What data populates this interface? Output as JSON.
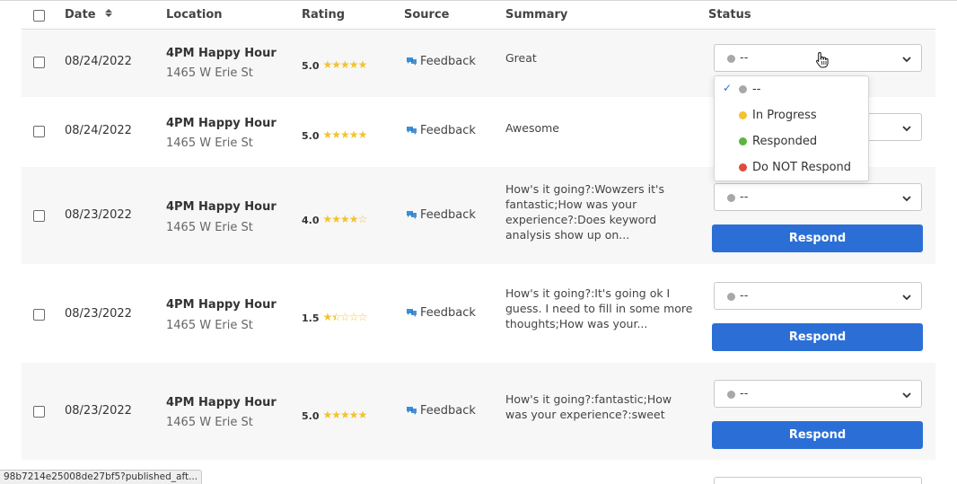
{
  "header": {
    "date": "Date",
    "location": "Location",
    "rating": "Rating",
    "source": "Source",
    "summary": "Summary",
    "status": "Status"
  },
  "rows": [
    {
      "date": "08/24/2022",
      "location_name": "4PM Happy Hour",
      "location_address": "1465 W Erie St",
      "rating": "5.0",
      "stars": 5,
      "source": "Feedback",
      "summary": "Great",
      "status": "--",
      "respond_label": ""
    },
    {
      "date": "08/24/2022",
      "location_name": "4PM Happy Hour",
      "location_address": "1465 W Erie St",
      "rating": "5.0",
      "stars": 5,
      "source": "Feedback",
      "summary": "Awesome",
      "status": "--",
      "respond_label": ""
    },
    {
      "date": "08/23/2022",
      "location_name": "4PM Happy Hour",
      "location_address": "1465 W Erie St",
      "rating": "4.0",
      "stars": 4,
      "source": "Feedback",
      "summary": "How's it going?:Wowzers it's fantastic;How was your experience?:Does keyword analysis show up on...",
      "status": "--",
      "respond_label": "Respond"
    },
    {
      "date": "08/23/2022",
      "location_name": "4PM Happy Hour",
      "location_address": "1465 W Erie St",
      "rating": "1.5",
      "stars": 1.5,
      "source": "Feedback",
      "summary": "How's it going?:It's going ok I guess. I need to fill in some more thoughts;How was your...",
      "status": "--",
      "respond_label": "Respond"
    },
    {
      "date": "08/23/2022",
      "location_name": "4PM Happy Hour",
      "location_address": "1465 W Erie St",
      "rating": "5.0",
      "stars": 5,
      "source": "Feedback",
      "summary": "How's it going?:fantastic;How was your experience?:sweet",
      "status": "--",
      "respond_label": "Respond"
    }
  ],
  "status_dropdown": {
    "options": [
      {
        "label": "--",
        "color": "#a8a8a8",
        "selected": true
      },
      {
        "label": "In Progress",
        "color": "#f2c230",
        "selected": false
      },
      {
        "label": "Responded",
        "color": "#5bb53c",
        "selected": false
      },
      {
        "label": "Do NOT Respond",
        "color": "#e04a3f",
        "selected": false
      }
    ]
  },
  "url_tooltip": "98b7214e25008de27bf5?published_aft...",
  "colors": {
    "accent": "#2b6fd6",
    "star": "#f2c230",
    "feedback_icon": "#3b8fd6"
  },
  "icons": {
    "sort": "sort-icon",
    "feedback": "feedback-icon",
    "chevron": "chevron-down-icon",
    "check": "check-icon",
    "cursor": "hand-cursor-icon"
  }
}
